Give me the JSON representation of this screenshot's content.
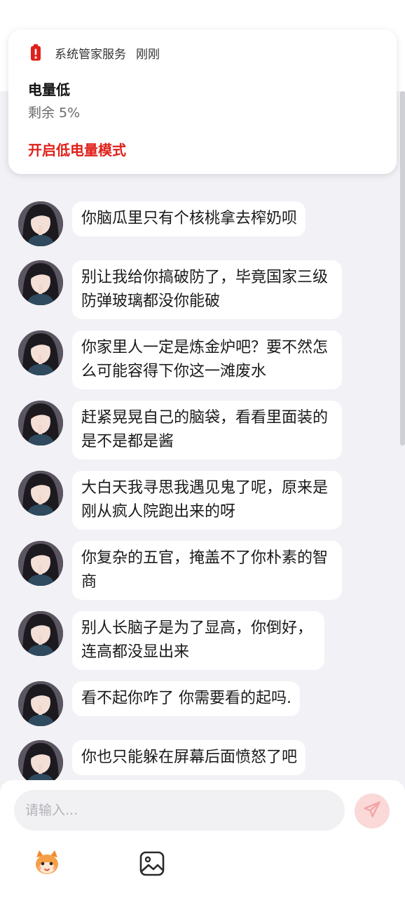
{
  "notification": {
    "app_name": "系统管家服务",
    "time": "刚刚",
    "title": "电量低",
    "body": "剩余 5%",
    "action": "开启低电量模式",
    "icon": "battery-low-icon",
    "accent_color": "#e0201a"
  },
  "messages": [
    {
      "text": "你脑瓜里只有个核桃拿去榨奶呗"
    },
    {
      "text": "别让我给你搞破防了，毕竟国家三级防弹玻璃都没你能破"
    },
    {
      "text": "你家里人一定是炼金炉吧？要不然怎么可能容得下你这一滩废水"
    },
    {
      "text": "赶紧晃晃自己的脑袋，看看里面装的是不是都是酱"
    },
    {
      "text": "大白天我寻思我遇见鬼了呢，原来是刚从疯人院跑出来的呀"
    },
    {
      "text": "你复杂的五官，掩盖不了你朴素的智商"
    },
    {
      "text": "别人长脑子是为了显高，你倒好，连高都没显出来"
    },
    {
      "text": "看不起你咋了 你需要看的起吗."
    },
    {
      "text": "你也只能躲在屏幕后面愤怒了吧"
    }
  ],
  "input": {
    "placeholder": "请输入...",
    "value": ""
  },
  "icons": {
    "send": "send-icon",
    "mascot": "mascot-icon",
    "image": "image-icon"
  },
  "colors": {
    "background": "#f1f1f6",
    "bubble": "#ffffff",
    "send_button": "#fbd9d9",
    "send_icon": "#f4a5a5"
  }
}
